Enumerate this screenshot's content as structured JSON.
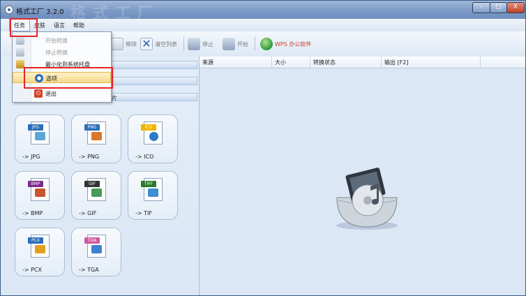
{
  "window": {
    "title": "格式工厂 3.2.0",
    "watermark": "格式工厂",
    "controls": {
      "minimize": "–",
      "maximize": "□",
      "close": "X"
    }
  },
  "menubar": {
    "items": [
      "任务",
      "皮肤",
      "语言",
      "帮助"
    ]
  },
  "toolbar": {
    "remove": "移除",
    "clear_list": "清空列表",
    "stop": "停止",
    "start": "开始",
    "wps": "WPS 办公软件"
  },
  "dropdown": {
    "items": [
      {
        "label": "开始转换",
        "disabled": true,
        "icon": "start-convert-icon"
      },
      {
        "label": "停止转换",
        "disabled": true,
        "icon": "stop-convert-icon"
      },
      {
        "label": "最小化到系统托盘",
        "disabled": false,
        "icon": "minimize-tray-icon"
      },
      {
        "label": "选项",
        "disabled": false,
        "highlighted": true,
        "icon": "options-icon"
      },
      {
        "label": "退出",
        "disabled": false,
        "icon": "exit-icon"
      }
    ]
  },
  "left_categories": [
    "频",
    "频",
    "图片"
  ],
  "tiles": [
    {
      "tag": "JPG",
      "label": "-> JPG",
      "tag_color": "#2a6eb8",
      "pic_color": "#5da6d8",
      "icon": "jpg-file-icon"
    },
    {
      "tag": "PNG",
      "label": "-> PNG",
      "tag_color": "#2a6eb8",
      "pic_color": "#d9772a",
      "icon": "png-file-icon"
    },
    {
      "tag": "ICO",
      "label": "-> ICO",
      "tag_color": "#f0b400",
      "pic_color": "#2a7cc7",
      "icon": "ico-file-icon"
    },
    {
      "tag": "BMP",
      "label": "-> BMP",
      "tag_color": "#7a2b8c",
      "pic_color": "#c9552f",
      "icon": "bmp-file-icon"
    },
    {
      "tag": "GIF",
      "label": "-> GIF",
      "tag_color": "#333333",
      "pic_color": "#4a9a5a",
      "icon": "gif-file-icon"
    },
    {
      "tag": "TIFF",
      "label": "-> TIF",
      "tag_color": "#2a7a2a",
      "pic_color": "#3c8fd0",
      "icon": "tif-file-icon"
    },
    {
      "tag": "PCX",
      "label": "-> PCX",
      "tag_color": "#2a6eb8",
      "pic_color": "#e0a01f",
      "icon": "pcx-file-icon"
    },
    {
      "tag": "TGA",
      "label": "-> TGA",
      "tag_color": "#d05aa0",
      "pic_color": "#3e7fd0",
      "icon": "tga-file-icon"
    }
  ],
  "columns": [
    "来源",
    "大小",
    "转换状态",
    "输出 [F2]"
  ],
  "colors": {
    "highlight_border": "#e2262a",
    "menu_highlight": "#f6d98b",
    "pane_bg": "#dbe7f5"
  }
}
